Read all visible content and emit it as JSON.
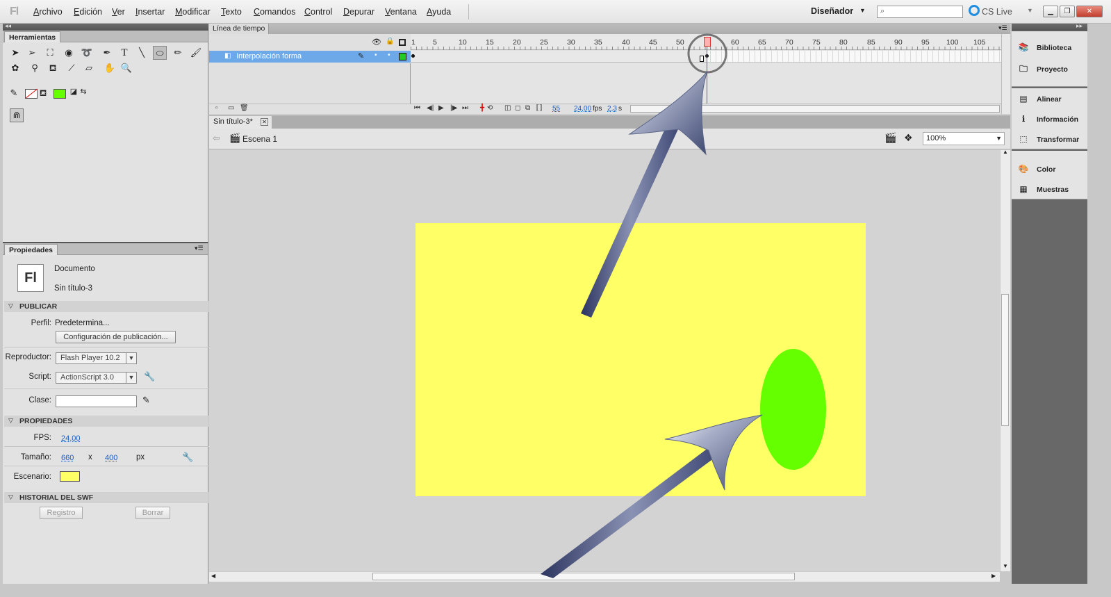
{
  "app": {
    "logo": "Fl"
  },
  "menu": [
    "Archivo",
    "Edición",
    "Ver",
    "Insertar",
    "Modificar",
    "Texto",
    "Comandos",
    "Control",
    "Depurar",
    "Ventana",
    "Ayuda"
  ],
  "workspace": "Diseñador",
  "search": {
    "placeholder": ""
  },
  "cslive": "CS Live",
  "tools": {
    "tab": "Herramientas",
    "row1": [
      "selection-arrow-icon",
      "subselection-icon",
      "free-transform-icon",
      "3d-rotation-icon",
      "lasso-icon",
      "pen-icon",
      "text-icon",
      "line-icon",
      "oval-icon",
      "pencil-icon",
      "brush-icon"
    ],
    "row2": [
      "deco-icon",
      "bone-icon",
      "paint-bucket-icon",
      "eyedropper-icon",
      "eraser-icon",
      "hand-icon",
      "zoom-icon"
    ],
    "stroke_color": "none",
    "fill_color": "#66ff00"
  },
  "properties": {
    "tab": "Propiedades",
    "doc_type": "Documento",
    "doc_name": "Sin título-3",
    "doc_icon": "Fl",
    "publish": {
      "header": "PUBLICAR",
      "profile_label": "Perfil:",
      "profile_value": "Predetermina...",
      "config_button": "Configuración de publicación..."
    },
    "player_label": "Reproductor:",
    "player_value": "Flash Player 10.2",
    "script_label": "Script:",
    "script_value": "ActionScript 3.0",
    "class_label": "Clase:",
    "class_value": "",
    "props_header": "PROPIEDADES",
    "fps_label": "FPS:",
    "fps_value": "24,00",
    "size_label": "Tamaño:",
    "width": "660",
    "x_sep": "x",
    "height": "400",
    "unit": "px",
    "stage_label": "Escenario:",
    "stage_color": "#ffff66",
    "swf_header": "HISTORIAL DEL SWF",
    "log_button": "Registro",
    "clear_button": "Borrar"
  },
  "timeline": {
    "tab": "Línea de tiempo",
    "ruler": [
      "1",
      "5",
      "10",
      "15",
      "20",
      "25",
      "30",
      "35",
      "40",
      "45",
      "50",
      "55",
      "60",
      "65",
      "70",
      "75",
      "80",
      "85",
      "90",
      "95",
      "100",
      "105"
    ],
    "layer_name": "Interpolación forma",
    "current_frame": "55",
    "fps": "24,00",
    "fps_unit": "fps",
    "time": "2,3",
    "time_unit": "s"
  },
  "document": {
    "tab": "Sin título-3*",
    "scene": "Escena 1",
    "zoom": "100%",
    "stage_color": "#ffff66",
    "shape_color": "#66ff00"
  },
  "dock": {
    "group1": [
      {
        "icon": "library-icon",
        "label": "Biblioteca"
      },
      {
        "icon": "project-icon",
        "label": "Proyecto"
      }
    ],
    "group2": [
      {
        "icon": "align-icon",
        "label": "Alinear"
      },
      {
        "icon": "info-icon",
        "label": "Información"
      },
      {
        "icon": "transform-icon",
        "label": "Transformar"
      }
    ],
    "group3": [
      {
        "icon": "color-icon",
        "label": "Color"
      },
      {
        "icon": "swatches-icon",
        "label": "Muestras"
      }
    ]
  }
}
